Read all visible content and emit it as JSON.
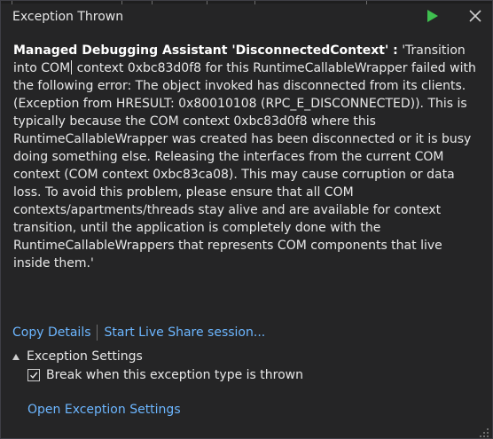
{
  "dialog": {
    "title": "Exception Thrown",
    "continue_icon": "play-icon",
    "close_icon": "close-icon",
    "message": {
      "heading": "Managed Debugging Assistant 'DisconnectedContext' :",
      "text_before_caret": " 'Transition into COM",
      "text_after_caret": " context 0xbc83d0f8 for this RuntimeCallableWrapper failed with the following error: The object invoked has disconnected from its clients. (Exception from HRESULT: 0x80010108 (RPC_E_DISCONNECTED)). This is typically because the COM context 0xbc83d0f8 where this RuntimeCallableWrapper was created has been disconnected or it is busy doing something else. Releasing the interfaces from the current COM context (COM context 0xbc83ca08). This may cause corruption or data loss. To avoid this problem, please ensure that all COM contexts/apartments/threads stay alive and are available for context transition, until the application is completely done with the RuntimeCallableWrappers that represents COM components that live inside them.'"
    },
    "links": {
      "copy_details": "Copy Details",
      "live_share": "Start Live Share session..."
    },
    "exception_settings": {
      "header": "Exception Settings",
      "expander_icon": "triangle-expanded-icon",
      "break_checkbox_label": "Break when this exception type is thrown",
      "break_checked": true,
      "open_settings_link": "Open Exception Settings"
    }
  },
  "colors": {
    "background": "#252526",
    "border": "#3f3f46",
    "text": "#e8e8e8",
    "link": "#6cb6ff",
    "play_green": "#3fbf4f"
  }
}
